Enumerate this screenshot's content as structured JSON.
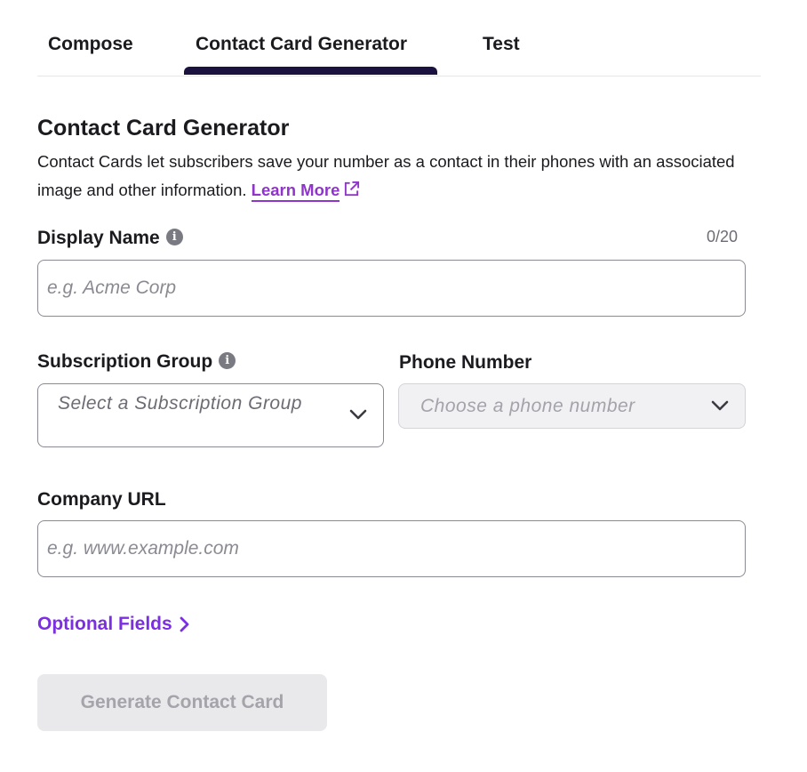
{
  "tabs": [
    {
      "label": "Compose"
    },
    {
      "label": "Contact Card Generator"
    },
    {
      "label": "Test"
    }
  ],
  "header": {
    "title": "Contact Card Generator",
    "description": "Contact Cards let subscribers save your number as a contact in their phones with an associated image and other information.",
    "learn_more": "Learn More"
  },
  "display_name": {
    "label": "Display Name",
    "counter": "0/20",
    "placeholder": "e.g. Acme Corp"
  },
  "subscription_group": {
    "label": "Subscription Group",
    "placeholder": "Select a Subscription Group"
  },
  "phone_number": {
    "label": "Phone Number",
    "placeholder": "Choose a phone number"
  },
  "company_url": {
    "label": "Company URL",
    "placeholder": "e.g. www.example.com"
  },
  "optional_fields": {
    "label": "Optional Fields"
  },
  "generate_button": {
    "label": "Generate Contact Card"
  },
  "icons": {
    "info": "info-circle-icon",
    "external_link": "external-link-icon",
    "chevron_down": "chevron-down-icon",
    "chevron_right": "chevron-right-icon"
  },
  "colors": {
    "active_tab_indicator": "#1b1240",
    "link": "#8f35c9",
    "optional_link": "#7b2fe0",
    "disabled_button_bg": "#e9e9ec"
  }
}
